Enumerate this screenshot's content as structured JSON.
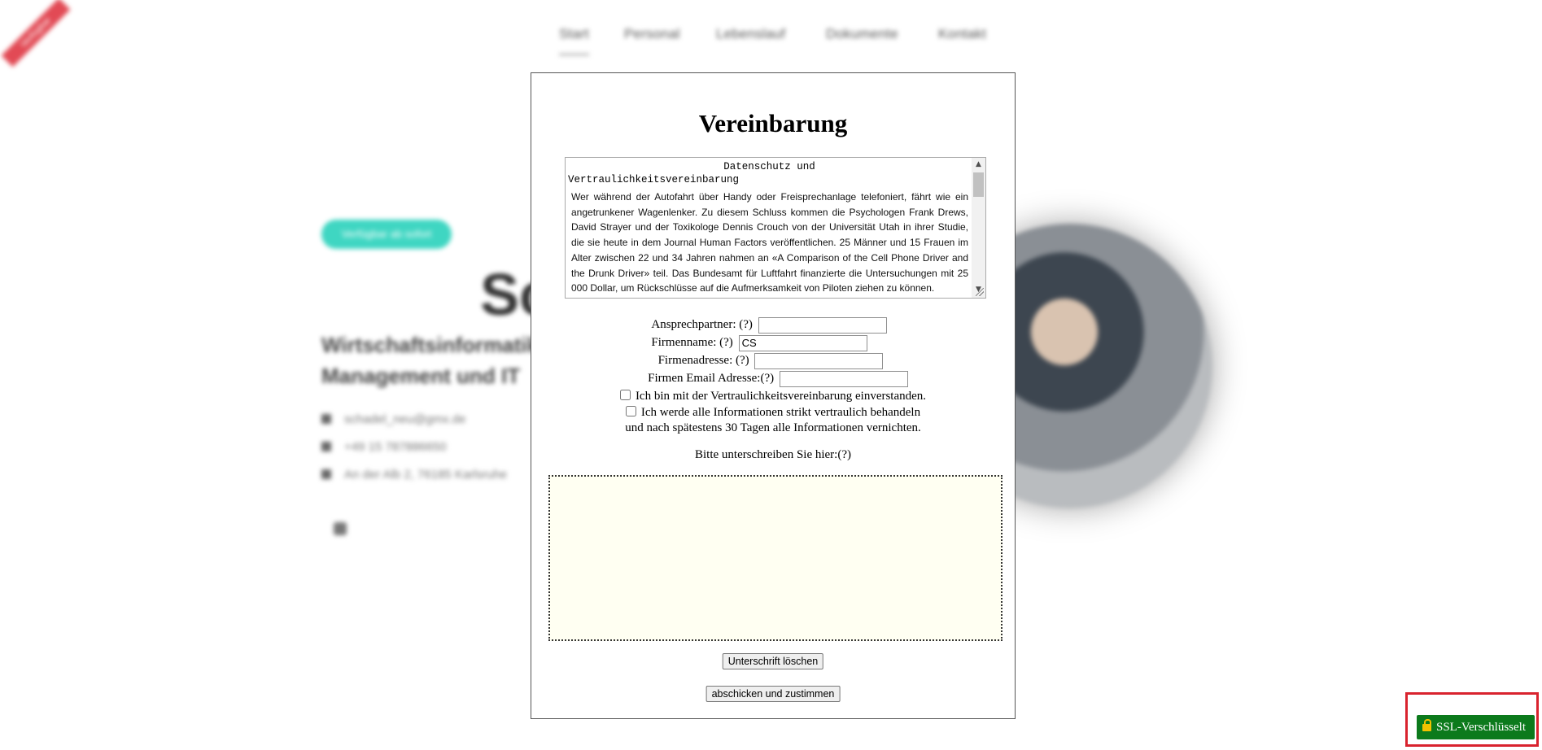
{
  "background": {
    "nav": [
      "Start",
      "Personal",
      "Lebenslauf",
      "Dokumente",
      "Kontakt"
    ],
    "active_nav": "Start",
    "ribbon_text": "Verfügbar",
    "badge_text": "Verfügbar ab sofort",
    "name_fragment": "Sc",
    "subtitle_line1": "Wirtschaftsinformatik",
    "subtitle_line2": "Management und IT",
    "contacts": [
      "schadel_neu@gmx.de",
      "+49 15 787886650",
      "An der Alb 2, 76185 Karlsruhe"
    ]
  },
  "modal": {
    "title": "Vereinbarung",
    "textarea": {
      "heading_line1": "Datenschutz und",
      "heading_line2": "Vertraulichkeitsvereinbarung",
      "body": "Wer während der Autofahrt über Handy oder Freisprechanlage telefoniert, fährt wie ein angetrunkener Wagenlenker. Zu diesem Schluss kommen die Psychologen Frank Drews, David Strayer und der Toxikologe Dennis Crouch von der Universität Utah in ihrer Studie, die sie heute in dem Journal Human Factors veröffentlichen. 25 Männer und 15 Frauen im Alter zwischen 22 und 34 Jahren nahmen an «A Comparison of the Cell Phone Driver and the Drunk Driver» teil. Das Bundesamt für Luftfahrt finanzierte die Untersuchungen mit 25 000 Dollar, um Rückschlüsse auf die Aufmerksamkeit von Piloten ziehen zu können.",
      "arrow_up": "▲",
      "arrow_down": "▼"
    },
    "fields": {
      "contact_label": "Ansprechpartner:",
      "contact_value": "",
      "company_label": "Firmenname:",
      "company_value": "CS",
      "address_label": "Firmenadresse:",
      "address_value": "",
      "email_label": "Firmen Email Adresse:",
      "email_value": "",
      "help_marker": "(?)"
    },
    "checkboxes": {
      "agree_label": "Ich bin mit der Vertraulichkeitsvereinbarung einverstanden.",
      "agree_checked": false,
      "confidential_line1": "Ich werde alle Informationen strikt vertraulich behandeln",
      "confidential_line2": "und nach spätestens 30 Tagen alle Informationen vernichten.",
      "confidential_checked": false
    },
    "signature_prompt": "Bitte unterschreiben Sie hier:",
    "clear_button": "Unterschrift löschen",
    "submit_button": "abschicken und zustimmen"
  },
  "ssl_badge": {
    "label": "SSL-Verschlüsselt",
    "color": "#0c7a1c",
    "frame_color": "#d9232e"
  }
}
